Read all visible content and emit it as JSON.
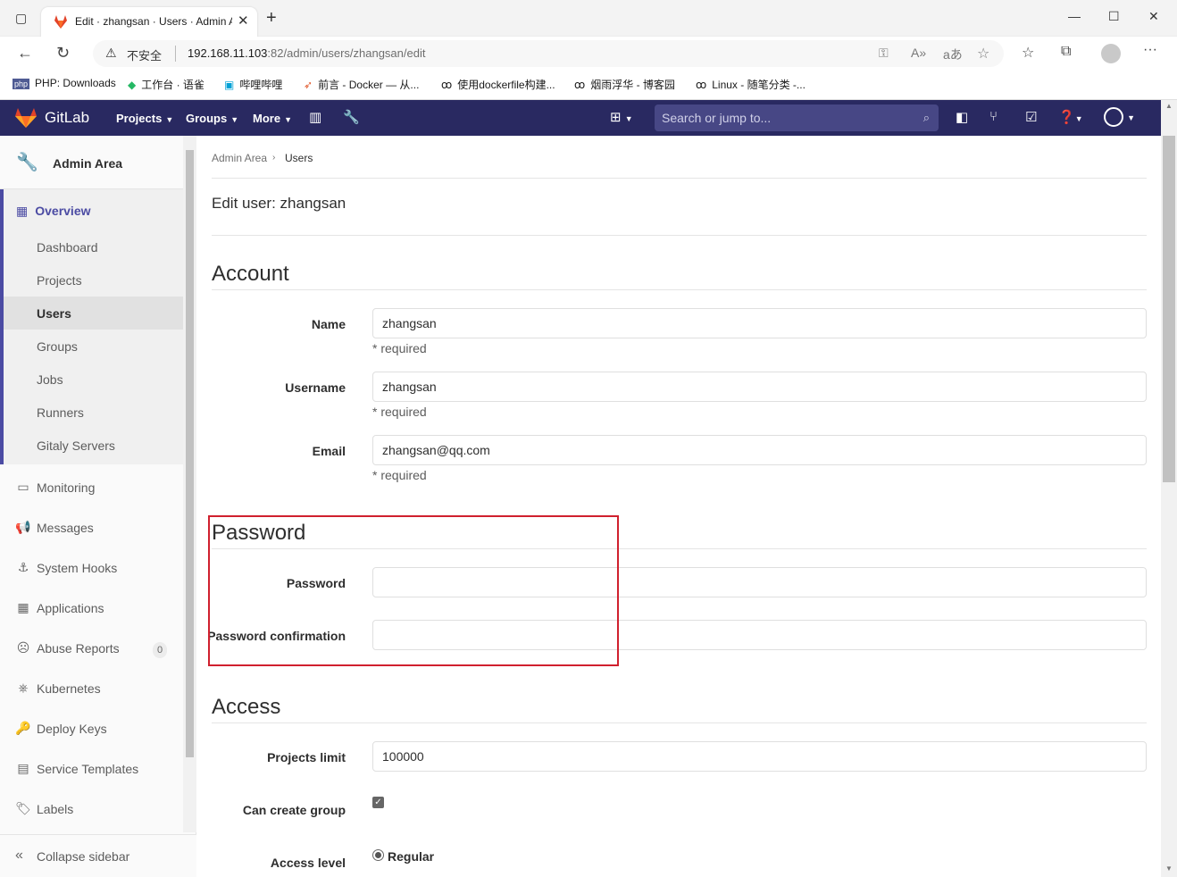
{
  "browser": {
    "tab_title": "Edit · zhangsan · Users · Admin Area",
    "insecure_label": "不安全",
    "url_host": "192.168.11.103",
    "url_rest": ":82/admin/users/zhangsan/edit",
    "bookmarks": [
      {
        "label": "PHP: Downloads",
        "icon": "php-icon"
      },
      {
        "label": "工作台 · 语雀",
        "icon": "yuque-icon"
      },
      {
        "label": "哔哩哔哩",
        "icon": "bilibili-icon"
      },
      {
        "label": "前言 - Docker — 从...",
        "icon": "rocket-icon"
      },
      {
        "label": "使用dockerfile构建...",
        "icon": "cnblogs-icon"
      },
      {
        "label": "烟雨浮华 - 博客园",
        "icon": "cnblogs-icon"
      },
      {
        "label": "Linux - 随笔分类 -...",
        "icon": "cnblogs-icon"
      }
    ]
  },
  "gitlab_nav": {
    "brand": "GitLab",
    "menus": [
      "Projects",
      "Groups",
      "More"
    ],
    "search_placeholder": "Search or jump to..."
  },
  "sidebar": {
    "title": "Admin Area",
    "overview": "Overview",
    "overview_items": [
      "Dashboard",
      "Projects",
      "Users",
      "Groups",
      "Jobs",
      "Runners",
      "Gitaly Servers"
    ],
    "items": [
      {
        "label": "Monitoring",
        "icon": "monitor-icon"
      },
      {
        "label": "Messages",
        "icon": "bullhorn-icon"
      },
      {
        "label": "System Hooks",
        "icon": "anchor-icon"
      },
      {
        "label": "Applications",
        "icon": "applications-icon"
      },
      {
        "label": "Abuse Reports",
        "icon": "abuse-icon",
        "badge": "0"
      },
      {
        "label": "Kubernetes",
        "icon": "kubernetes-icon"
      },
      {
        "label": "Deploy Keys",
        "icon": "key-icon"
      },
      {
        "label": "Service Templates",
        "icon": "template-icon"
      },
      {
        "label": "Labels",
        "icon": "label-icon"
      }
    ],
    "collapse": "Collapse sidebar"
  },
  "main": {
    "breadcrumb": [
      "Admin Area",
      "Users"
    ],
    "title": "Edit user: zhangsan",
    "account": {
      "heading": "Account",
      "name_label": "Name",
      "name_value": "zhangsan",
      "username_label": "Username",
      "username_value": "zhangsan",
      "email_label": "Email",
      "email_value": "zhangsan@qq.com",
      "required": "* required"
    },
    "password": {
      "heading": "Password",
      "password_label": "Password",
      "confirm_label": "Password confirmation"
    },
    "access": {
      "heading": "Access",
      "projects_limit_label": "Projects limit",
      "projects_limit_value": "100000",
      "can_create_group_label": "Can create group",
      "can_create_group_checked": true,
      "access_level_label": "Access level",
      "access_level_value": "Regular"
    }
  },
  "colors": {
    "gitlab_nav_bg": "#292961",
    "accent": "#4b4ba3",
    "highlight_box": "#d0202e"
  }
}
